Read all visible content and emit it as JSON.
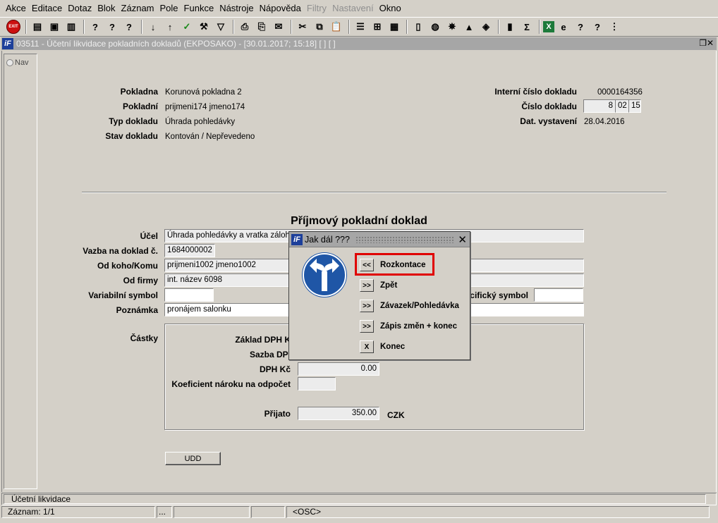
{
  "menu": [
    "Akce",
    "Editace",
    "Dotaz",
    "Blok",
    "Záznam",
    "Pole",
    "Funkce",
    "Nástroje",
    "Nápověda",
    "Filtry",
    "Nastavení",
    "Okno"
  ],
  "menu_disabled": [
    "Filtry",
    "Nastavení"
  ],
  "toolbar": {
    "exit_label": "EXIT",
    "icons": [
      "record-add-icon",
      "record-save-icon",
      "record-delete-icon",
      "query-icon",
      "query-run-icon",
      "query-cancel-icon",
      "sort-asc-icon",
      "sort-desc-icon",
      "check-icon",
      "tools-icon",
      "filter-icon",
      "print-icon",
      "print-preview-icon",
      "mail-icon",
      "cut-icon",
      "copy-icon",
      "paste-icon",
      "list-icon",
      "tree-icon",
      "calculator-icon",
      "document-icon",
      "globe-icon",
      "wheel-icon",
      "mountain-icon",
      "chart-icon",
      "mobile-icon",
      "sum-icon",
      "excel-icon",
      "ie-icon",
      "help-icon",
      "context-help-icon",
      "more-icon"
    ]
  },
  "window": {
    "title": "03511 - Účetní likvidace pokladních dokladů (EKPOSAKO) - [30.01.2017; 15:18]  [ ]  [ ]",
    "logo": "iF"
  },
  "nav": {
    "label": "Nav"
  },
  "header": {
    "pokladna_label": "Pokladna",
    "pokladna": "Korunová pokladna 2",
    "pokladni_label": "Pokladní",
    "pokladni": "prijmeni174 jmeno174",
    "typ_label": "Typ dokladu",
    "typ": "Úhrada pohledávky",
    "stav_label": "Stav dokladu",
    "stav": "Kontován / Nepřevedeno",
    "interni_label": "Interní číslo dokladu",
    "interni": "0000164356",
    "cislo_label": "Číslo dokladu",
    "cislo_a": "8",
    "cislo_b": "02",
    "cislo_c": "15",
    "datum_label": "Dat. vystavení",
    "datum": "28.04.2016"
  },
  "doc": {
    "heading": "Příjmový pokladní doklad",
    "ucel_label": "Účel",
    "ucel": "Úhrada pohledávky a vratka záloh",
    "vazba_label": "Vazba na doklad č.",
    "vazba": "1684000002",
    "odkoho_label": "Od koho/Komu",
    "odkoho": "prijmeni1002 jmeno1002",
    "firma_label": "Od firmy",
    "firma": "int. název 6098",
    "vs_label": "Variabilní symbol",
    "vs": "",
    "ss_label": "cifický symbol",
    "ss": "",
    "pozn_label": "Poznámka",
    "pozn": "pronájem salonku"
  },
  "castky": {
    "group_label": "Částky",
    "zaklad_label": "Základ DPH K",
    "sazba_label": "Sazba DPI",
    "dph_label": "DPH Kč",
    "dph": "0.00",
    "koef_label": "Koeficient nároku na odpočet",
    "koef": "",
    "prijato_label": "Přijato",
    "prijato": "350.00",
    "mena": "CZK"
  },
  "udd_button": "UDD",
  "dialog": {
    "title": "Jak dál ???",
    "close": "✕",
    "options": [
      {
        "btn": "<<",
        "label": "Rozkontace"
      },
      {
        "btn": ">>",
        "label": "Zpět"
      },
      {
        "btn": ">>",
        "label": "Závazek/Pohledávka"
      },
      {
        "btn": ">>",
        "label": "Zápis změn + konec"
      },
      {
        "btn": "X",
        "label": "Konec"
      }
    ]
  },
  "status": {
    "line1": "Účetní likvidace",
    "zaznam": "Záznam: 1/1",
    "dots": "...",
    "osc": "<OSC>"
  }
}
